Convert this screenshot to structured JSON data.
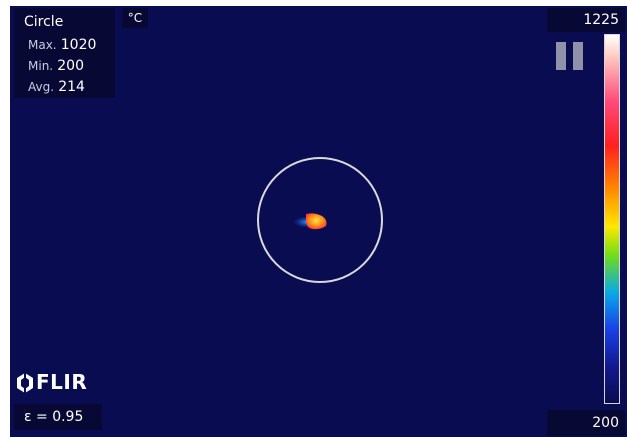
{
  "measurement": {
    "tool_label": "Circle",
    "max_key": "Max.",
    "max_value": "1020",
    "min_key": "Min.",
    "min_value": "200",
    "avg_key": "Avg.",
    "avg_value": "214"
  },
  "unit_label": "°C",
  "scale": {
    "max_label": "1225",
    "min_label": "200",
    "palette": "iron/rainbow high-contrast"
  },
  "brand": {
    "logo_text": "FLIR"
  },
  "emissivity_label": "ε = 0.95",
  "colors": {
    "background": "#0a0c52",
    "panel": "#070934",
    "circle_outline": "#d9d9d9",
    "hotspot_core": "#ffcc33",
    "hotspot_edge": "#ff3b3b"
  },
  "icons": {
    "pause": "pause-icon",
    "measurement_circle": "circle-measurement-icon"
  }
}
